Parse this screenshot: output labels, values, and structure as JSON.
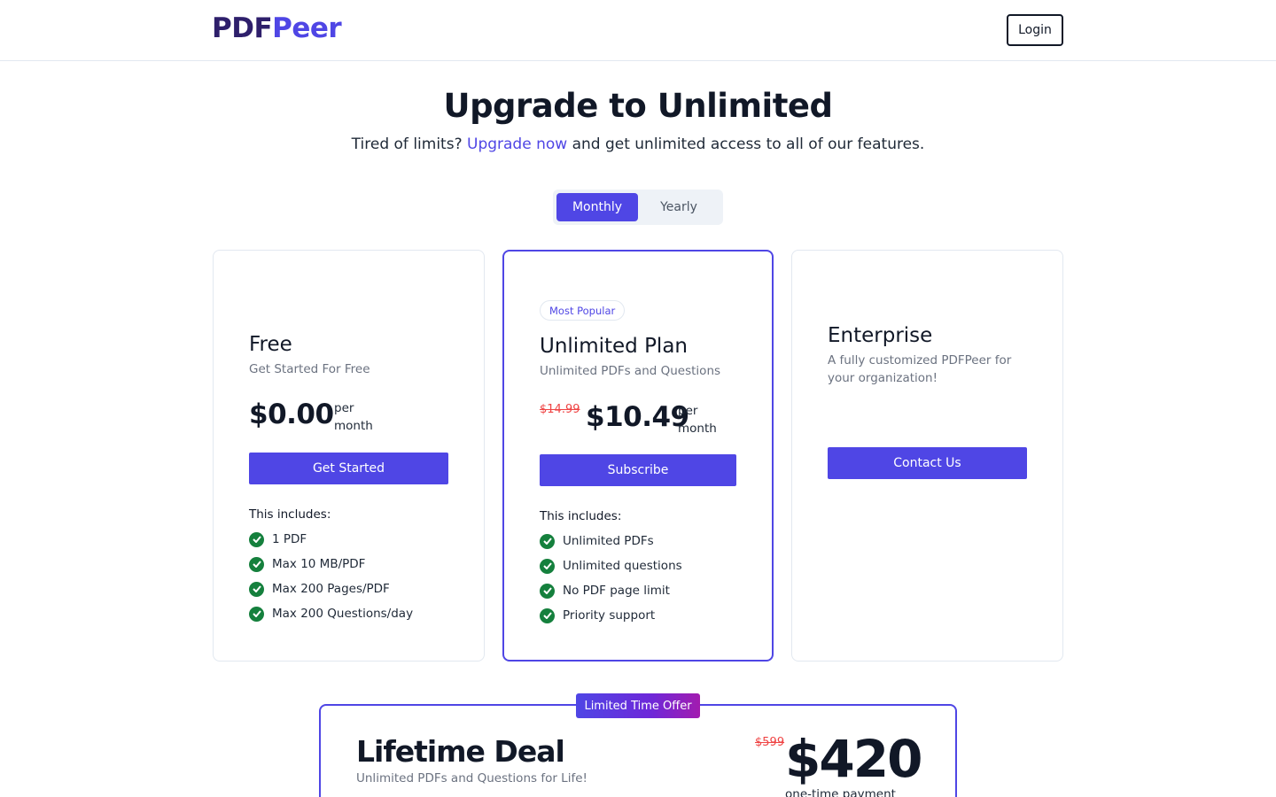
{
  "header": {
    "logo_part1": "PDF",
    "logo_part2": "Peer",
    "login_label": "Login"
  },
  "hero": {
    "title": "Upgrade to Unlimited",
    "subtitle_before": "Tired of limits? ",
    "subtitle_link": "Upgrade now",
    "subtitle_after": " and get unlimited access to all of our features."
  },
  "billing_toggle": {
    "options": [
      "Monthly",
      "Yearly"
    ],
    "selected": "Monthly"
  },
  "plans": {
    "free": {
      "name": "Free",
      "description": "Get Started For Free",
      "price": "$0.00",
      "per_line1": "per",
      "per_line2": "month",
      "cta": "Get Started",
      "includes_label": "This includes:",
      "features": [
        "1 PDF",
        "Max 10 MB/PDF",
        "Max 200 Pages/PDF",
        "Max 200 Questions/day"
      ]
    },
    "unlimited": {
      "badge": "Most Popular",
      "name": "Unlimited Plan",
      "description": "Unlimited PDFs and Questions",
      "old_price": "$14.99",
      "price": "$10.49",
      "per_line1": "per",
      "per_line2": "month",
      "cta": "Subscribe",
      "includes_label": "This includes:",
      "features": [
        "Unlimited PDFs",
        "Unlimited questions",
        "No PDF page limit",
        "Priority support"
      ]
    },
    "enterprise": {
      "name": "Enterprise",
      "description_line1": "A fully customized PDFPeer for",
      "description_line2": "your organization!",
      "cta": "Contact Us"
    }
  },
  "lifetime": {
    "badge": "Limited Time Offer",
    "title": "Lifetime Deal",
    "description": "Unlimited PDFs and Questions for Life!",
    "old_price": "$599",
    "price": "$420",
    "note": "one-time payment"
  },
  "colors": {
    "accent": "#4f46e5",
    "logo_dark": "#2e1f6b",
    "check_green": "#15803d",
    "strike_red": "#ef4444"
  }
}
